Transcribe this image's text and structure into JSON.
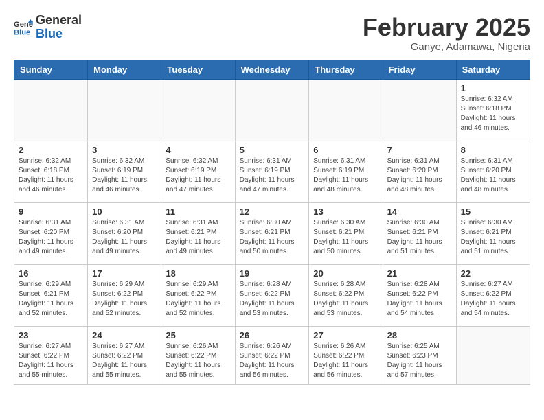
{
  "header": {
    "logo_general": "General",
    "logo_blue": "Blue",
    "month_title": "February 2025",
    "location": "Ganye, Adamawa, Nigeria"
  },
  "weekdays": [
    "Sunday",
    "Monday",
    "Tuesday",
    "Wednesday",
    "Thursday",
    "Friday",
    "Saturday"
  ],
  "weeks": [
    [
      {
        "day": "",
        "info": ""
      },
      {
        "day": "",
        "info": ""
      },
      {
        "day": "",
        "info": ""
      },
      {
        "day": "",
        "info": ""
      },
      {
        "day": "",
        "info": ""
      },
      {
        "day": "",
        "info": ""
      },
      {
        "day": "1",
        "info": "Sunrise: 6:32 AM\nSunset: 6:18 PM\nDaylight: 11 hours\nand 46 minutes."
      }
    ],
    [
      {
        "day": "2",
        "info": "Sunrise: 6:32 AM\nSunset: 6:18 PM\nDaylight: 11 hours\nand 46 minutes."
      },
      {
        "day": "3",
        "info": "Sunrise: 6:32 AM\nSunset: 6:19 PM\nDaylight: 11 hours\nand 46 minutes."
      },
      {
        "day": "4",
        "info": "Sunrise: 6:32 AM\nSunset: 6:19 PM\nDaylight: 11 hours\nand 47 minutes."
      },
      {
        "day": "5",
        "info": "Sunrise: 6:31 AM\nSunset: 6:19 PM\nDaylight: 11 hours\nand 47 minutes."
      },
      {
        "day": "6",
        "info": "Sunrise: 6:31 AM\nSunset: 6:19 PM\nDaylight: 11 hours\nand 48 minutes."
      },
      {
        "day": "7",
        "info": "Sunrise: 6:31 AM\nSunset: 6:20 PM\nDaylight: 11 hours\nand 48 minutes."
      },
      {
        "day": "8",
        "info": "Sunrise: 6:31 AM\nSunset: 6:20 PM\nDaylight: 11 hours\nand 48 minutes."
      }
    ],
    [
      {
        "day": "9",
        "info": "Sunrise: 6:31 AM\nSunset: 6:20 PM\nDaylight: 11 hours\nand 49 minutes."
      },
      {
        "day": "10",
        "info": "Sunrise: 6:31 AM\nSunset: 6:20 PM\nDaylight: 11 hours\nand 49 minutes."
      },
      {
        "day": "11",
        "info": "Sunrise: 6:31 AM\nSunset: 6:21 PM\nDaylight: 11 hours\nand 49 minutes."
      },
      {
        "day": "12",
        "info": "Sunrise: 6:30 AM\nSunset: 6:21 PM\nDaylight: 11 hours\nand 50 minutes."
      },
      {
        "day": "13",
        "info": "Sunrise: 6:30 AM\nSunset: 6:21 PM\nDaylight: 11 hours\nand 50 minutes."
      },
      {
        "day": "14",
        "info": "Sunrise: 6:30 AM\nSunset: 6:21 PM\nDaylight: 11 hours\nand 51 minutes."
      },
      {
        "day": "15",
        "info": "Sunrise: 6:30 AM\nSunset: 6:21 PM\nDaylight: 11 hours\nand 51 minutes."
      }
    ],
    [
      {
        "day": "16",
        "info": "Sunrise: 6:29 AM\nSunset: 6:21 PM\nDaylight: 11 hours\nand 52 minutes."
      },
      {
        "day": "17",
        "info": "Sunrise: 6:29 AM\nSunset: 6:22 PM\nDaylight: 11 hours\nand 52 minutes."
      },
      {
        "day": "18",
        "info": "Sunrise: 6:29 AM\nSunset: 6:22 PM\nDaylight: 11 hours\nand 52 minutes."
      },
      {
        "day": "19",
        "info": "Sunrise: 6:28 AM\nSunset: 6:22 PM\nDaylight: 11 hours\nand 53 minutes."
      },
      {
        "day": "20",
        "info": "Sunrise: 6:28 AM\nSunset: 6:22 PM\nDaylight: 11 hours\nand 53 minutes."
      },
      {
        "day": "21",
        "info": "Sunrise: 6:28 AM\nSunset: 6:22 PM\nDaylight: 11 hours\nand 54 minutes."
      },
      {
        "day": "22",
        "info": "Sunrise: 6:27 AM\nSunset: 6:22 PM\nDaylight: 11 hours\nand 54 minutes."
      }
    ],
    [
      {
        "day": "23",
        "info": "Sunrise: 6:27 AM\nSunset: 6:22 PM\nDaylight: 11 hours\nand 55 minutes."
      },
      {
        "day": "24",
        "info": "Sunrise: 6:27 AM\nSunset: 6:22 PM\nDaylight: 11 hours\nand 55 minutes."
      },
      {
        "day": "25",
        "info": "Sunrise: 6:26 AM\nSunset: 6:22 PM\nDaylight: 11 hours\nand 55 minutes."
      },
      {
        "day": "26",
        "info": "Sunrise: 6:26 AM\nSunset: 6:22 PM\nDaylight: 11 hours\nand 56 minutes."
      },
      {
        "day": "27",
        "info": "Sunrise: 6:26 AM\nSunset: 6:22 PM\nDaylight: 11 hours\nand 56 minutes."
      },
      {
        "day": "28",
        "info": "Sunrise: 6:25 AM\nSunset: 6:23 PM\nDaylight: 11 hours\nand 57 minutes."
      },
      {
        "day": "",
        "info": ""
      }
    ]
  ]
}
